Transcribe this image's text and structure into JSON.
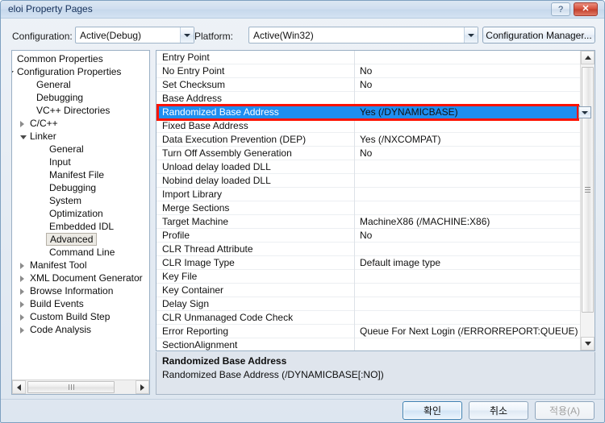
{
  "window": {
    "title": "eloi Property Pages",
    "help_button": "?",
    "close_button": "✕"
  },
  "config_bar": {
    "configuration_label": "Configuration:",
    "configuration_value": "Active(Debug)",
    "platform_label": "Platform:",
    "platform_value": "Active(Win32)",
    "configuration_manager_button": "Configuration Manager..."
  },
  "tree": {
    "nodes": [
      {
        "label": "Common Properties",
        "indent": 6,
        "state": "collapsed"
      },
      {
        "label": "Configuration Properties",
        "indent": 6,
        "state": "expanded"
      },
      {
        "label": "General",
        "indent": 30,
        "state": "leaf"
      },
      {
        "label": "Debugging",
        "indent": 30,
        "state": "leaf"
      },
      {
        "label": "VC++ Directories",
        "indent": 30,
        "state": "leaf"
      },
      {
        "label": "C/C++",
        "indent": 22,
        "state": "collapsed"
      },
      {
        "label": "Linker",
        "indent": 22,
        "state": "expanded"
      },
      {
        "label": "General",
        "indent": 46,
        "state": "leaf"
      },
      {
        "label": "Input",
        "indent": 46,
        "state": "leaf"
      },
      {
        "label": "Manifest File",
        "indent": 46,
        "state": "leaf"
      },
      {
        "label": "Debugging",
        "indent": 46,
        "state": "leaf"
      },
      {
        "label": "System",
        "indent": 46,
        "state": "leaf"
      },
      {
        "label": "Optimization",
        "indent": 46,
        "state": "leaf"
      },
      {
        "label": "Embedded IDL",
        "indent": 46,
        "state": "leaf"
      },
      {
        "label": "Advanced",
        "indent": 46,
        "state": "selected"
      },
      {
        "label": "Command Line",
        "indent": 46,
        "state": "leaf"
      },
      {
        "label": "Manifest Tool",
        "indent": 22,
        "state": "collapsed"
      },
      {
        "label": "XML Document Generator",
        "indent": 22,
        "state": "collapsed"
      },
      {
        "label": "Browse Information",
        "indent": 22,
        "state": "collapsed"
      },
      {
        "label": "Build Events",
        "indent": 22,
        "state": "collapsed"
      },
      {
        "label": "Custom Build Step",
        "indent": 22,
        "state": "collapsed"
      },
      {
        "label": "Code Analysis",
        "indent": 22,
        "state": "collapsed"
      }
    ]
  },
  "grid": {
    "rows": [
      {
        "name": "Entry Point",
        "value": ""
      },
      {
        "name": "No Entry Point",
        "value": "No"
      },
      {
        "name": "Set Checksum",
        "value": "No"
      },
      {
        "name": "Base Address",
        "value": ""
      },
      {
        "name": "Randomized Base Address",
        "value": "Yes (/DYNAMICBASE)",
        "selected": true
      },
      {
        "name": "Fixed Base Address",
        "value": ""
      },
      {
        "name": "Data Execution Prevention (DEP)",
        "value": "Yes (/NXCOMPAT)"
      },
      {
        "name": "Turn Off Assembly Generation",
        "value": "No"
      },
      {
        "name": "Unload delay loaded DLL",
        "value": ""
      },
      {
        "name": "Nobind delay loaded DLL",
        "value": ""
      },
      {
        "name": "Import Library",
        "value": ""
      },
      {
        "name": "Merge Sections",
        "value": ""
      },
      {
        "name": "Target Machine",
        "value": "MachineX86 (/MACHINE:X86)"
      },
      {
        "name": "Profile",
        "value": "No"
      },
      {
        "name": "CLR Thread Attribute",
        "value": ""
      },
      {
        "name": "CLR Image Type",
        "value": "Default image type"
      },
      {
        "name": "Key File",
        "value": ""
      },
      {
        "name": "Key Container",
        "value": ""
      },
      {
        "name": "Delay Sign",
        "value": ""
      },
      {
        "name": "CLR Unmanaged Code Check",
        "value": ""
      },
      {
        "name": "Error Reporting",
        "value": "Queue For Next Login (/ERRORREPORT:QUEUE)"
      },
      {
        "name": "SectionAlignment",
        "value": ""
      }
    ]
  },
  "description": {
    "title": "Randomized Base Address",
    "text": "Randomized Base Address (/DYNAMICBASE[:NO])"
  },
  "footer": {
    "ok": "확인",
    "cancel": "취소",
    "apply": "적용(A)"
  },
  "colors": {
    "selection_blue": "#1f8ef0",
    "highlight_red": "#ff1200",
    "description_bg": "#dfe5ed"
  }
}
